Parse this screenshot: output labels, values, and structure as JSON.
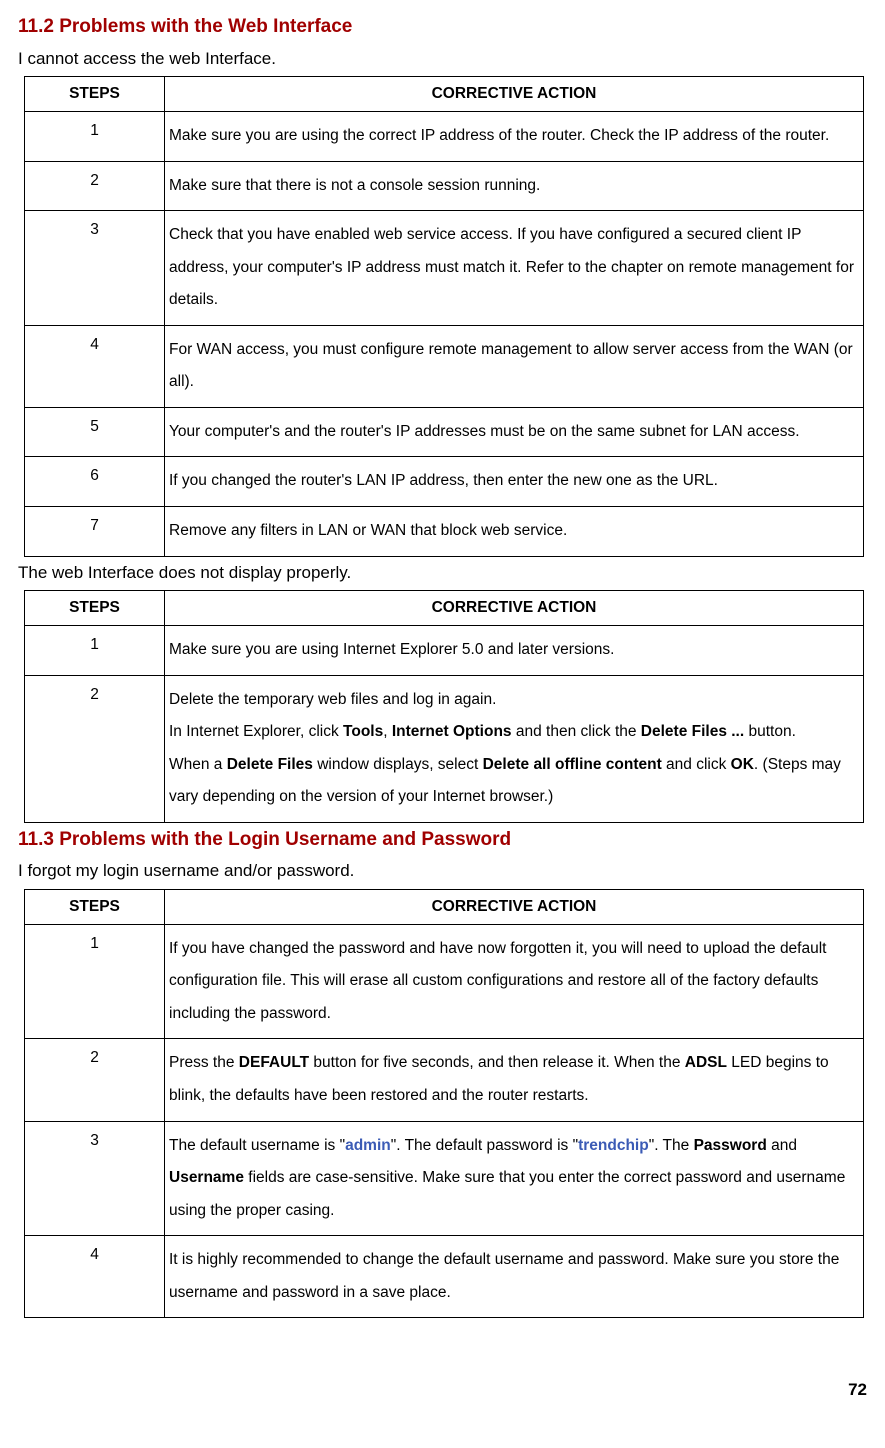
{
  "section_11_2": {
    "heading": "11.2 Problems with the Web Interface",
    "intro1": "I cannot access the web Interface.",
    "table1": {
      "head_steps": "STEPS",
      "head_action": "CORRECTIVE ACTION",
      "rows": [
        {
          "step": "1",
          "action": "Make sure you are using the correct IP address of the router. Check the IP address of the router."
        },
        {
          "step": "2",
          "action": "Make sure that there is not a console session running."
        },
        {
          "step": "3",
          "action": "Check that you have enabled web service access. If you have configured a secured client IP address, your computer's IP address must match it. Refer to the chapter on remote management for details."
        },
        {
          "step": "4",
          "action": "For WAN access, you must configure remote management to allow server access from the WAN (or all)."
        },
        {
          "step": "5",
          "action": "Your computer's and the router's IP addresses must be on the same subnet for LAN access."
        },
        {
          "step": "6",
          "action": "If you changed the router's LAN IP address, then enter the new one as the URL."
        },
        {
          "step": "7",
          "action": "Remove any filters in LAN or WAN that block web service."
        }
      ]
    },
    "intro2": "The web Interface does not display properly.",
    "table2": {
      "head_steps": "STEPS",
      "head_action": "CORRECTIVE ACTION",
      "row1": {
        "step": "1",
        "action": "Make sure you are using Internet Explorer 5.0 and later versions."
      },
      "row2": {
        "step": "2",
        "line1_a": "Delete the temporary web files and log in again.",
        "line2_a": "In Internet Explorer, click ",
        "line2_b_tools": "Tools",
        "line2_c": ", ",
        "line2_d_io": "Internet Options",
        "line2_e": " and then click the ",
        "line2_f_df": "Delete Files ...",
        "line2_g": " button.",
        "line3_a": "When a ",
        "line3_b_df": "Delete Files",
        "line3_c": " window displays, select ",
        "line3_d_daoc": "Delete all offline content",
        "line3_e": " and click ",
        "line3_f_ok": "OK",
        "line3_g": ". (Steps may vary depending on the version of your Internet browser.)"
      }
    }
  },
  "section_11_3": {
    "heading": "11.3 Problems with the Login Username and Password",
    "intro": "I forgot my login username and/or password.",
    "table": {
      "head_steps": "STEPS",
      "head_action": "CORRECTIVE ACTION",
      "row1": {
        "step": "1",
        "action": "If you have changed the password and have now forgotten it, you will need to upload the default configuration file. This will erase all custom configurations and restore all of the factory defaults including the password."
      },
      "row2": {
        "step": "2",
        "a": "Press the ",
        "b_default": "DEFAULT",
        "c": " button for five seconds, and then release it. When the ",
        "d_adsl": "ADSL",
        "e": " LED begins to blink, the defaults have been restored and the router restarts."
      },
      "row3": {
        "step": "3",
        "a": "The default username is \"",
        "b_admin": "admin",
        "c": "\". The default password is \"",
        "d_trendchip": "trendchip",
        "e": "\". The ",
        "f_password": "Password",
        "g": " and ",
        "h_username": "Username",
        "i": " fields are case-sensitive. Make sure that you enter the correct password and username using the proper casing."
      },
      "row4": {
        "step": "4",
        "action": "It is highly recommended to change the default username and password. Make sure you store the username and password in a save place."
      }
    }
  },
  "page_number": "72"
}
